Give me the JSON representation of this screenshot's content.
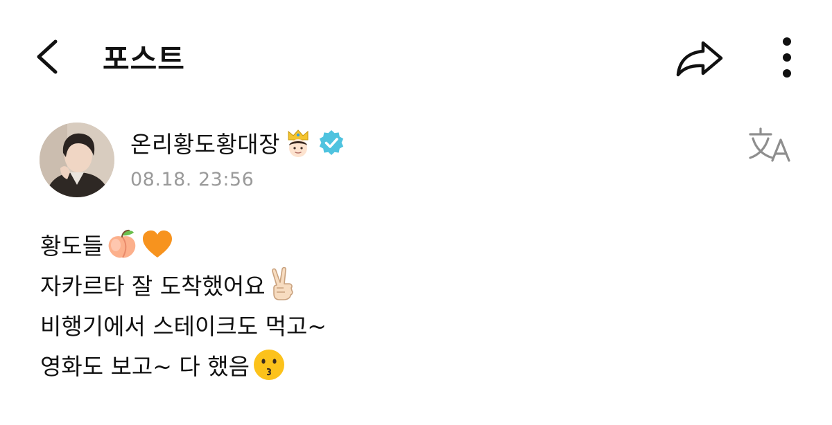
{
  "header": {
    "title": "포스트",
    "back_icon": "chevron-left-icon",
    "share_icon": "share-arrow-icon",
    "more_icon": "more-vertical-icon"
  },
  "post": {
    "author": "온리황도황대장",
    "author_emoji": "crown-prince-emoji",
    "verified_icon": "verified-badge-icon",
    "verified_color": "#4fc3df",
    "timestamp": "08.18. 23:56",
    "translate_icon": "translate-icon",
    "lines": [
      {
        "text": "황도들",
        "emojis": [
          "peach-emoji",
          "orange-heart-emoji"
        ]
      },
      {
        "text": "자카르타 잘 도착했어요",
        "emojis": [
          "victory-hand-emoji"
        ]
      },
      {
        "text": "비행기에서 스테이크도 먹고~",
        "emojis": []
      },
      {
        "text": "영화도 보고~ 다 했음 ",
        "emojis": [
          "kissing-face-emoji"
        ]
      }
    ]
  }
}
